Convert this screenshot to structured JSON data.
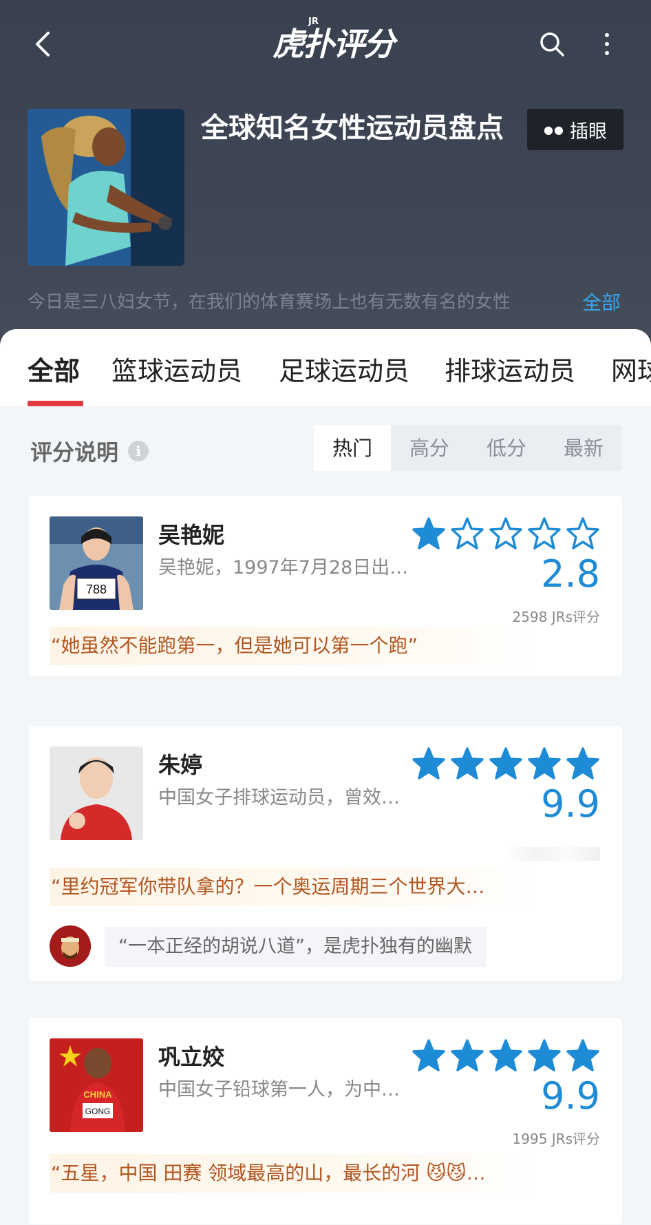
{
  "nav": {
    "logo": "虎扑评分",
    "logo_badge": "JR"
  },
  "topic": {
    "title": "全球知名女性运动员盘点",
    "peek_label": "插眼",
    "peek_icon": "eyes-icon",
    "intro": "今日是三八妇女节，在我们的体育赛场上也有无数有名的女性",
    "all_link": "全部"
  },
  "tabs": [
    "全部",
    "篮球运动员",
    "足球运动员",
    "排球运动员",
    "网球"
  ],
  "rating_help": "评分说明",
  "sort_options": [
    "热门",
    "高分",
    "低分",
    "最新"
  ],
  "sort_selected": "热门",
  "colors": {
    "accent": "#e0393e",
    "star": "#1e8bd6",
    "score": "#1e8bd6",
    "quote": "#b25520"
  },
  "items": [
    {
      "name": "吴艳妮",
      "desc": "吴艳妮，1997年7月28日出…",
      "rating_stars": 1,
      "score": "2.8",
      "count": "2598 JRs评分",
      "quote": "“她虽然不能跑第一，但是她可以第一个跑”",
      "bib": "788"
    },
    {
      "name": "朱婷",
      "desc": "中国女子排球运动员，曾效…",
      "rating_stars": 5,
      "score": "9.9",
      "quote": "“里约冠军你带队拿的？一个奥运周期三个世界大…",
      "reply": "“一本正经的胡说八道”，是虎扑独有的幽默"
    },
    {
      "name": "巩立姣",
      "desc": "中国女子铅球第一人，为中…",
      "rating_stars": 5,
      "score": "9.9",
      "count": "1995 JRs评分",
      "quote": "“五星，中国 田赛 领域最高的山，最长的河",
      "quote_tail": "…",
      "bib": "GONG",
      "jersey_text": "CHINA"
    }
  ]
}
